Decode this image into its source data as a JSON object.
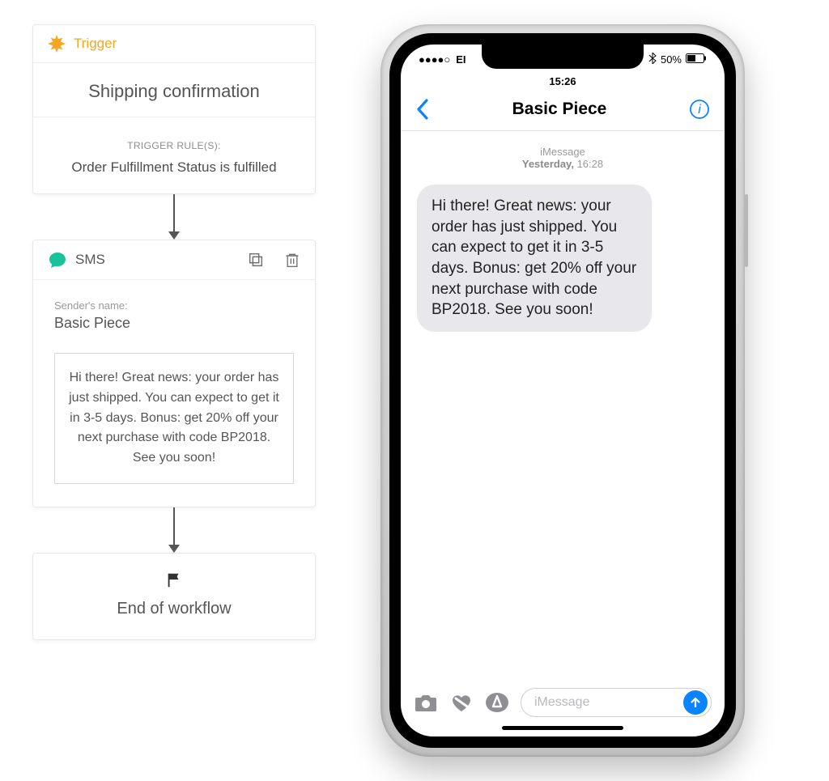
{
  "workflow": {
    "trigger": {
      "header": "Trigger",
      "title": "Shipping confirmation",
      "rules_label": "TRIGGER RULE(S):",
      "rule": "Order Fulfillment Status is fulfilled"
    },
    "sms": {
      "header": "SMS",
      "sender_label": "Sender's name:",
      "sender_name": "Basic Piece",
      "message": "Hi there! Great news: your order has just shipped. You can expect to get it in 3-5 days. Bonus: get 20% off your next purchase with code BP2018. See you soon!"
    },
    "end_label": "End of workflow"
  },
  "phone": {
    "status": {
      "carrier": "EI",
      "time": "15:26",
      "battery": "50%"
    },
    "title": "Basic Piece",
    "thread_meta": {
      "channel": "iMessage",
      "day": "Yesterday,",
      "time": "16:28"
    },
    "bubble": "Hi there! Great news: your order has just shipped. You can expect to get it in 3-5 days. Bonus: get 20% off your next purchase with code BP2018. See you soon!",
    "composer_placeholder": "iMessage"
  },
  "colors": {
    "accent_orange": "#f5a623",
    "accent_green": "#1bc19a",
    "ios_blue": "#0b84ff"
  }
}
